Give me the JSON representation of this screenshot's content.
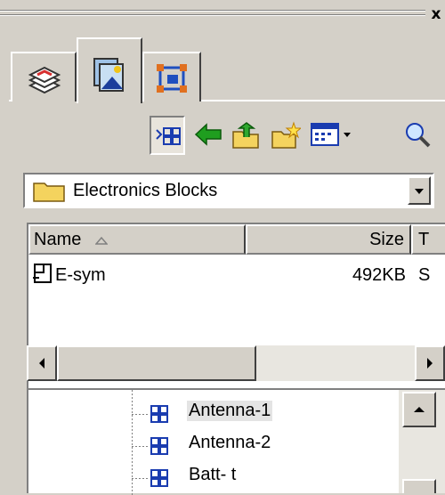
{
  "window": {
    "close_glyph": "x"
  },
  "tabs": [
    {
      "name": "layers",
      "icon": "layers-icon"
    },
    {
      "name": "block-library",
      "icon": "block-library-icon",
      "active": true
    },
    {
      "name": "selection",
      "icon": "selection-icon"
    }
  ],
  "toolbar": {
    "buttons": [
      {
        "name": "tree-view-toggle",
        "icon": "tree-grid-icon",
        "pressed": true
      },
      {
        "name": "back",
        "icon": "green-arrow-left-icon"
      },
      {
        "name": "up-folder",
        "icon": "folder-up-icon"
      },
      {
        "name": "new-folder",
        "icon": "new-folder-icon"
      },
      {
        "name": "view-options",
        "icon": "view-menu-icon",
        "has_dropdown": true
      },
      {
        "name": "search",
        "icon": "magnifier-icon"
      }
    ]
  },
  "folder_select": {
    "value": "Electronics Blocks",
    "icon": "folder-icon"
  },
  "list": {
    "columns": [
      {
        "label": "Name",
        "sort": "ascending"
      },
      {
        "label": "Size"
      },
      {
        "label": "T"
      }
    ],
    "rows": [
      {
        "name": "E-sym",
        "size": "492KB",
        "type": "S",
        "icon": "symbol-file-icon"
      }
    ]
  },
  "tree": {
    "items": [
      {
        "label": "Antenna-1",
        "icon": "block-grid-icon",
        "selected": true
      },
      {
        "label": "Antenna-2",
        "icon": "block-grid-icon"
      },
      {
        "label": "Batt- t",
        "icon": "block-grid-icon"
      }
    ]
  },
  "colors": {
    "face": "#d4d0c8",
    "tree_icon": "#1a3cb0",
    "arrow_green": "#1f9e1f",
    "folder_yellow": "#f4d35e"
  }
}
